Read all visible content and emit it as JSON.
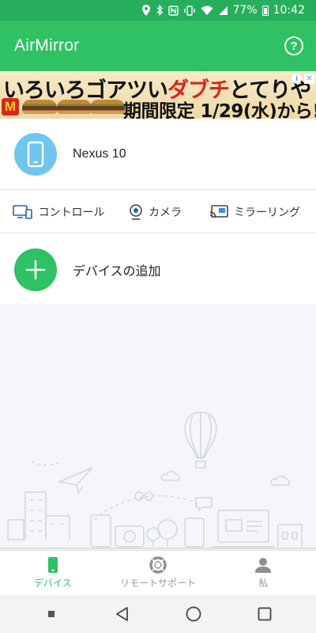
{
  "status_bar": {
    "battery": "77%",
    "time": "10:42",
    "icons": [
      "location-icon",
      "bluetooth-icon",
      "nfc-icon",
      "vibrate-icon",
      "wifi-icon",
      "signal-icon",
      "battery-icon"
    ]
  },
  "app_bar": {
    "title": "AirMirror",
    "help_icon": "help-circle-icon"
  },
  "ad": {
    "headline_black_1": "いろいろゴアツい",
    "headline_red": "ダブチ",
    "headline_black_2": "とてりや",
    "subline": "期間限定 1/29(水)から!",
    "logo": "M"
  },
  "device": {
    "name": "Nexus 10",
    "icon": "phone-icon"
  },
  "actions": [
    {
      "label": "コントロール",
      "icon": "remote-control-icon"
    },
    {
      "label": "カメラ",
      "icon": "camera-icon"
    },
    {
      "label": "ミラーリング",
      "icon": "cast-icon"
    }
  ],
  "add_device": {
    "label": "デバイスの追加",
    "icon": "plus-icon"
  },
  "bottom_nav": [
    {
      "label": "デバイス",
      "icon": "device-icon",
      "active": true
    },
    {
      "label": "リモートサポート",
      "icon": "lifebuoy-icon",
      "active": false
    },
    {
      "label": "私",
      "icon": "person-icon",
      "active": false
    }
  ],
  "colors": {
    "status_bar": "#27ae5d",
    "app_bar": "#2fc163",
    "accent": "#2fc163",
    "device_avatar": "#6ec6ef",
    "background": "#f4f6fa"
  }
}
